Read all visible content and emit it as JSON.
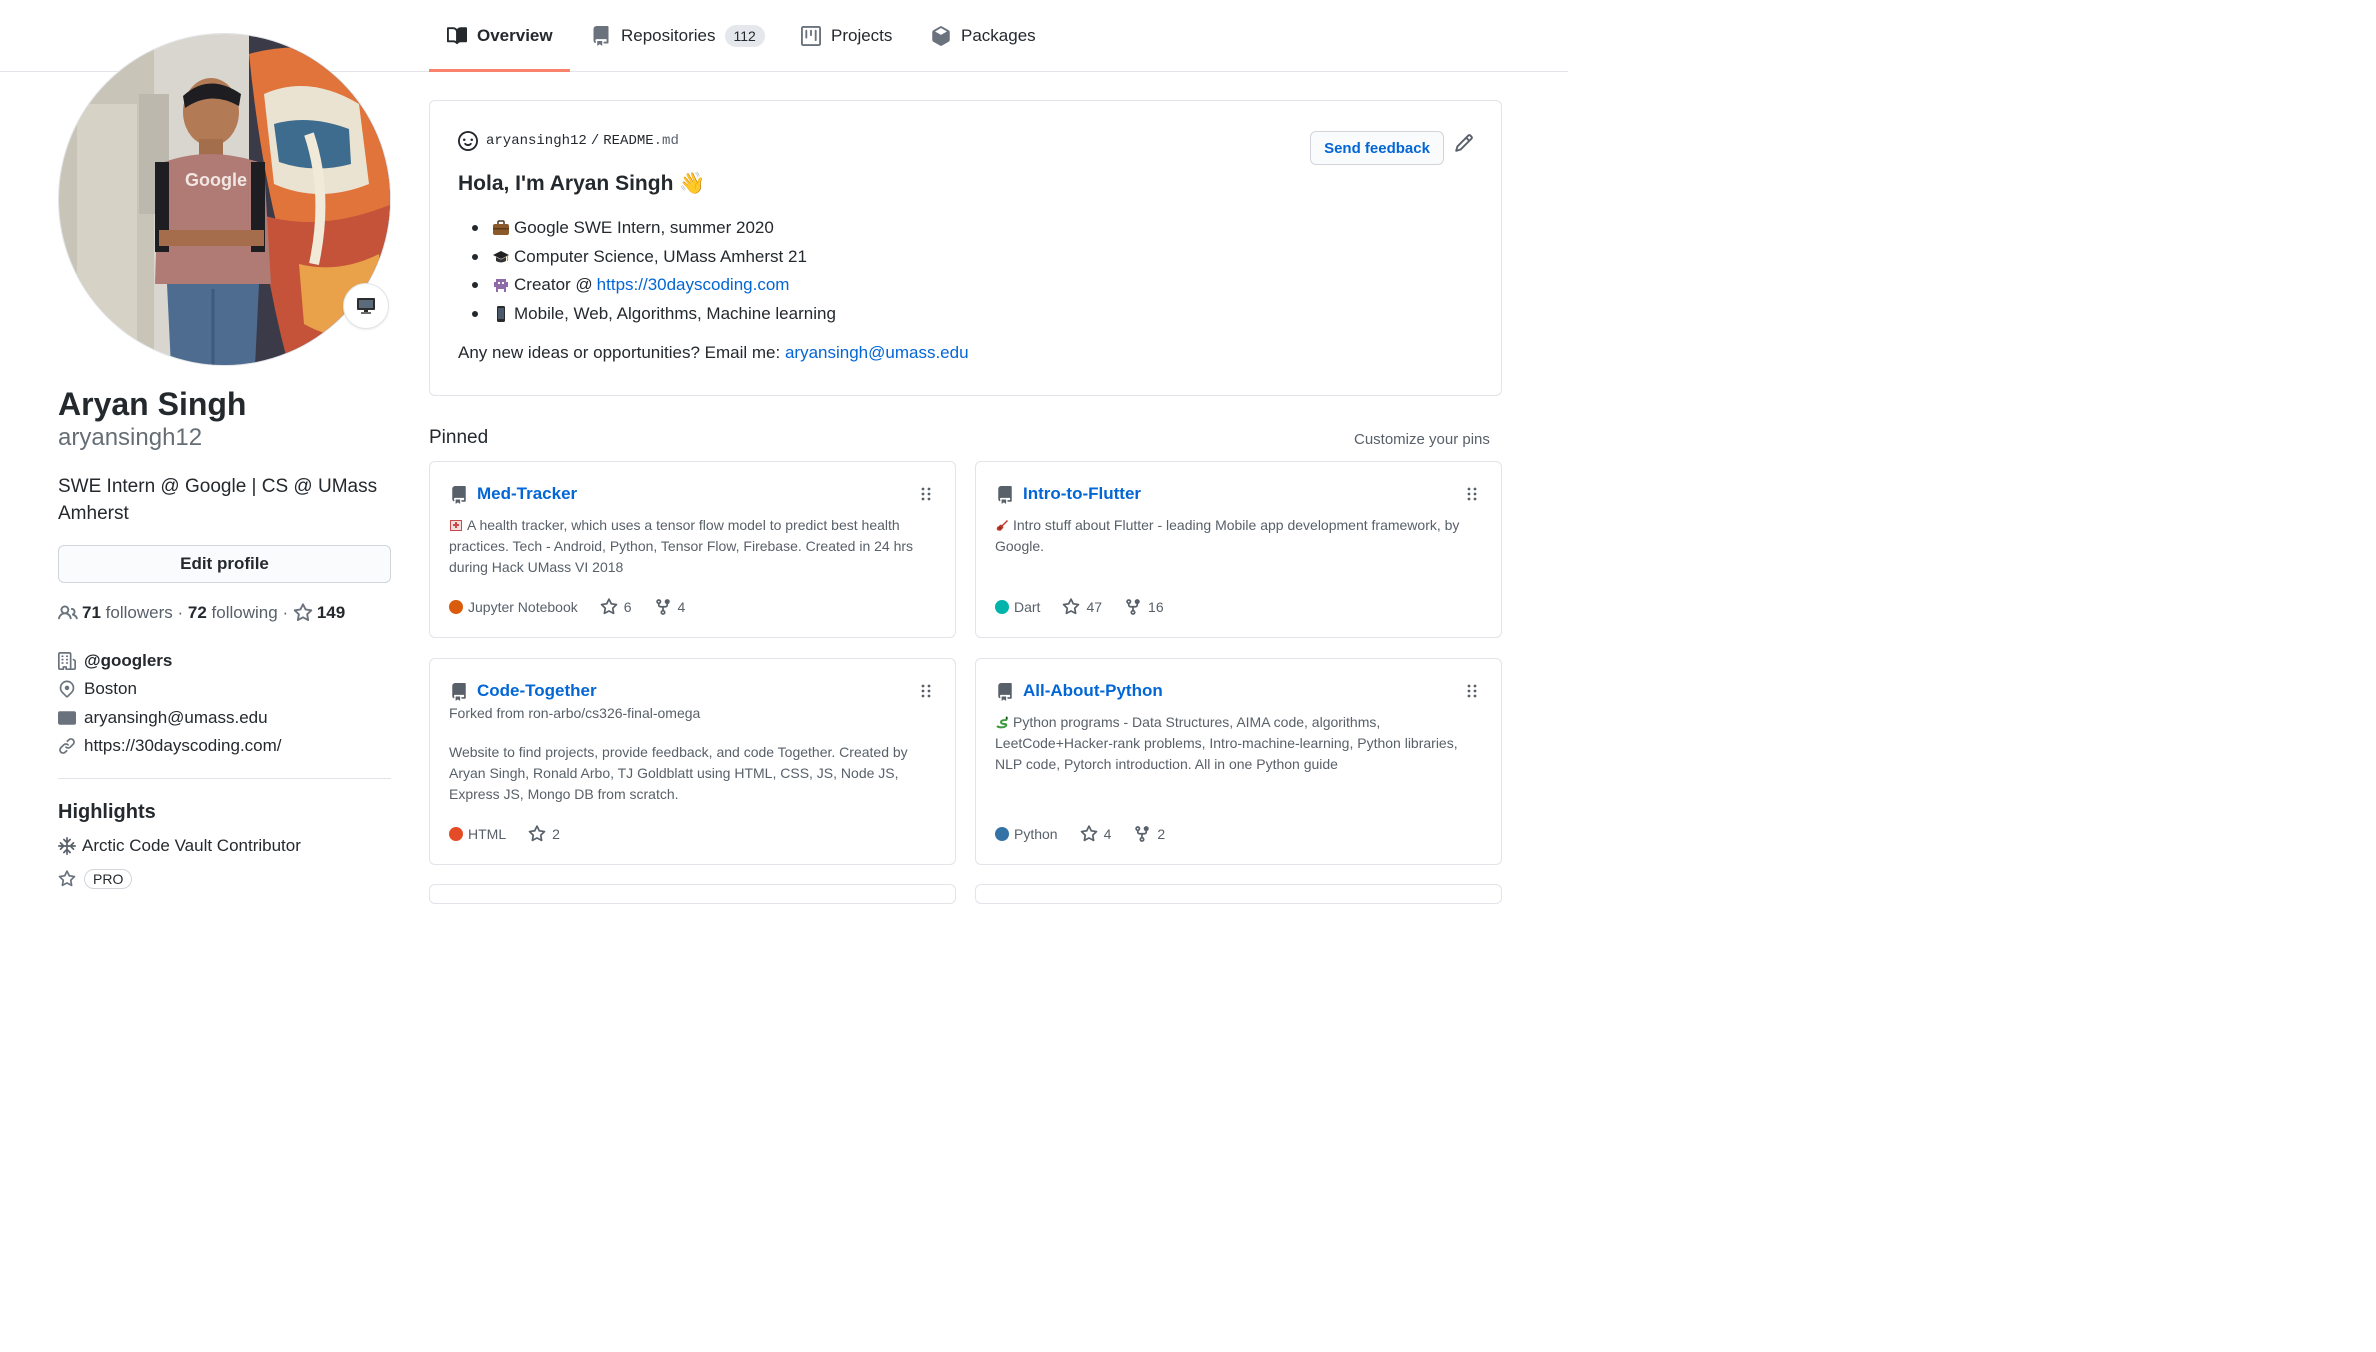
{
  "tabs": [
    {
      "label": "Overview",
      "icon": "book-icon",
      "active": true
    },
    {
      "label": "Repositories",
      "icon": "repo-icon",
      "count": "112"
    },
    {
      "label": "Projects",
      "icon": "project-icon"
    },
    {
      "label": "Packages",
      "icon": "package-icon"
    }
  ],
  "profile": {
    "name": "Aryan Singh",
    "login": "aryansingh12",
    "bio": "SWE Intern @ Google | CS @ UMass Amherst",
    "edit_label": "Edit profile",
    "avatar_shirt_text": "Google",
    "followers_count": "71",
    "followers_label": "followers",
    "following_count": "72",
    "following_label": "following",
    "separator": "·",
    "stars_count": "149",
    "organization": "@googlers",
    "location": "Boston",
    "email": "aryansingh@umass.edu",
    "website": "https://30dayscoding.com/"
  },
  "highlights": {
    "title": "Highlights",
    "items": [
      "Arctic Code Vault Contributor"
    ],
    "pro_label": "PRO"
  },
  "readme": {
    "owner": "aryansingh12",
    "slash": "/",
    "file": "README",
    "ext": ".md",
    "feedback_label": "Send feedback",
    "heading": "Hola, I'm Aryan Singh",
    "heading_emoji": "👋",
    "items": [
      {
        "text": "Google SWE Intern, summer 2020",
        "emoji": "briefcase"
      },
      {
        "text": "Computer Science, UMass Amherst 21",
        "emoji": "graduation-cap"
      },
      {
        "text": "Creator @ ",
        "link": "https://30dayscoding.com",
        "emoji": "alien-monster"
      },
      {
        "text": "Mobile, Web, Algorithms, Machine learning",
        "emoji": "mobile-phone"
      }
    ],
    "contact_text": "Any new ideas or opportunities? Email me: ",
    "contact_email": "aryansingh@umass.edu"
  },
  "pinned": {
    "title": "Pinned",
    "customize_label": "Customize your pins",
    "repos": [
      {
        "name": "Med-Tracker",
        "description": "A health tracker, which uses a tensor flow model to predict best health practices. Tech - Android, Python, Tensor Flow, Firebase. Created in 24 hrs during Hack UMass VI 2018",
        "language": "Jupyter Notebook",
        "language_color": "#DA5B0B",
        "stars": "6",
        "forks": "4"
      },
      {
        "name": "Intro-to-Flutter",
        "description": "Intro stuff about Flutter - leading Mobile app development framework, by Google.",
        "language": "Dart",
        "language_color": "#00B4AB",
        "stars": "47",
        "forks": "16"
      },
      {
        "name": "Code-Together",
        "forked_from": "Forked from ron-arbo/cs326-final-omega",
        "description": "Website to find projects, provide feedback, and code Together. Created by Aryan Singh, Ronald Arbo, TJ Goldblatt using HTML, CSS, JS, Node JS, Express JS, Mongo DB from scratch.",
        "language": "HTML",
        "language_color": "#E34C26",
        "stars": "2"
      },
      {
        "name": "All-About-Python",
        "description": "Python programs - Data Structures, AIMA code, algorithms, LeetCode+Hacker-rank problems, Intro-machine-learning, Python libraries, NLP code, Pytorch introduction. All in one Python guide",
        "language": "Python",
        "language_color": "#3572A5",
        "stars": "4",
        "forks": "2"
      }
    ]
  },
  "colors": {
    "link": "#0366d6",
    "tab_underline": "#f9826c",
    "border": "#e1e4e8",
    "muted": "#586069"
  }
}
